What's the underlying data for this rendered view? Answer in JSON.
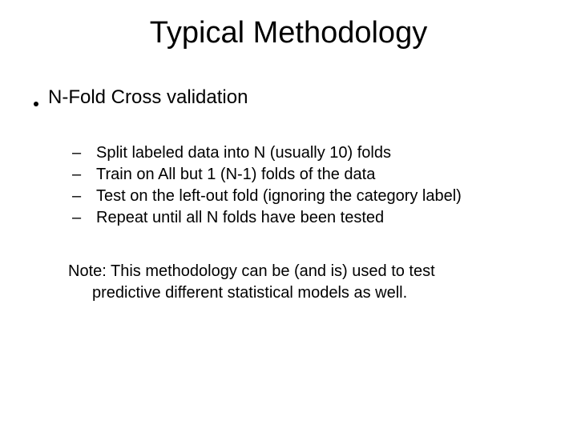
{
  "title": "Typical Methodology",
  "main_bullet": "N-Fold Cross validation",
  "subs": [
    "Split labeled data into N (usually 10) folds",
    "Train on All but 1 (N-1) folds of the data",
    "Test on the left-out fold (ignoring the category label)",
    "Repeat until all N folds have been tested"
  ],
  "note_line1": "Note: This methodology can be (and is) used to test",
  "note_line2": "predictive different statistical models as well.",
  "dash": "–"
}
